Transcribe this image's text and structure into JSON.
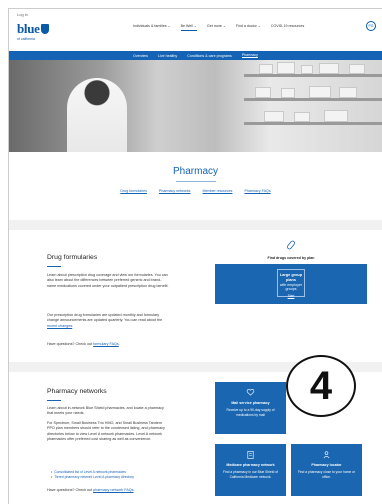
{
  "utility": {
    "label": "Log in"
  },
  "brand": {
    "name": "blue",
    "sub": "of california"
  },
  "top_nav": [
    {
      "label": "Individuals & families ⌄"
    },
    {
      "label": "Be Well ⌄",
      "active": true
    },
    {
      "label": "Get more ⌄"
    },
    {
      "label": "Find a doctor ⌄"
    },
    {
      "label": "COVID-19 resources"
    }
  ],
  "profile": {
    "label": "PG"
  },
  "sub_nav": [
    {
      "label": "Overview"
    },
    {
      "label": "Live healthy"
    },
    {
      "label": "Conditions & care programs"
    },
    {
      "label": "Pharmacy",
      "active": true
    }
  ],
  "page": {
    "title": "Pharmacy",
    "links": [
      "Drug formularies",
      "Pharmacy networks",
      "Member resources",
      "Pharmacy FAQs"
    ]
  },
  "formularies": {
    "title": "Drug formularies",
    "p1": "Learn about prescription drug coverage and view our formularies. You can also learn about the differences between preferred generic and brand-name medications covered under your outpatient prescription drug benefit.",
    "p2_pre": "Our prescription drug formularies are updated monthly and formulary change announcements are updated quarterly. You can read about the ",
    "p2_link": "recent changes",
    "p2_post": ".",
    "q_pre": "Have questions? Check out ",
    "q_link": "formulary FAQs",
    "q_post": ".",
    "find_caption": "Find drugs covered by plan",
    "plan_title": "Large group plans",
    "plan_sub": "with employer groups",
    "plan_link": "Start"
  },
  "networks": {
    "title": "Pharmacy networks",
    "p1": "Learn about in-network Blue Shield pharmacies, and locate a pharmacy that meets your needs.",
    "p2": "For Spectrum, Small Business Trio HMO, and Small Business Tandem PPO plan members should refer to the condensed listing, and pharmacy directories below to view Level A network pharmacies. Level A network pharmacies offer preferred cost sharing as well as convenience.",
    "bullets": [
      "Consolidated list of Level A network pharmacies",
      "Tiered pharmacy network Level A pharmacy directory"
    ],
    "q_pre": "Have questions? Check out ",
    "q_link": "pharmacy network FAQs",
    "q_post": ".",
    "cards": [
      {
        "title": "Mail service pharmacy",
        "desc": "Receive up to a 90-day supply of medications by mail",
        "icon": "heart-hands-icon"
      },
      {
        "title": "Medicare pharmacy network",
        "desc": "Find a pharmacy in our Blue Shield of California Medicare network.",
        "icon": "clipboard-icon"
      },
      {
        "title": "Pharmacy locator",
        "desc": "Find a pharmacy close to your home or office.",
        "icon": "person-pin-icon"
      }
    ]
  },
  "annotation": {
    "label": "4"
  },
  "colors": {
    "brand_blue": "#1463b4",
    "card_blue": "#1a66b0"
  }
}
